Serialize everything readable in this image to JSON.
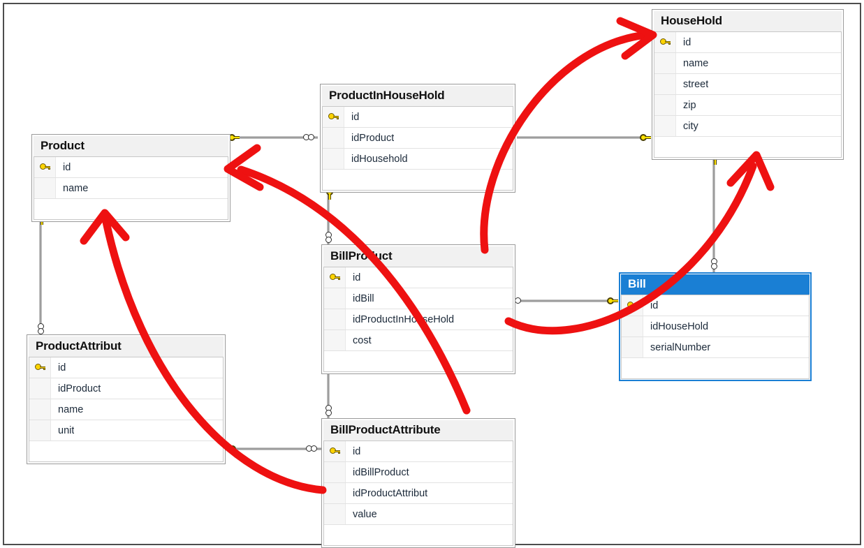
{
  "diagram": {
    "kind": "database-er-diagram",
    "border_color": "#4d4d4d",
    "background": "#ffffff",
    "selected_table": "Bill",
    "selection_color": "#1a7fd4",
    "annotation_color": "#ee1111"
  },
  "tables": [
    {
      "id": "product",
      "name": "Product",
      "selected": false,
      "fields": [
        {
          "name": "id",
          "primary_key": true
        },
        {
          "name": "name",
          "primary_key": false
        }
      ]
    },
    {
      "id": "productinhousehold",
      "name": "ProductInHouseHold",
      "selected": false,
      "fields": [
        {
          "name": "id",
          "primary_key": true
        },
        {
          "name": "idProduct",
          "primary_key": false
        },
        {
          "name": "idHousehold",
          "primary_key": false
        }
      ]
    },
    {
      "id": "household",
      "name": "HouseHold",
      "selected": false,
      "fields": [
        {
          "name": "id",
          "primary_key": true
        },
        {
          "name": "name",
          "primary_key": false
        },
        {
          "name": "street",
          "primary_key": false
        },
        {
          "name": "zip",
          "primary_key": false
        },
        {
          "name": "city",
          "primary_key": false
        }
      ]
    },
    {
      "id": "billproduct",
      "name": "BillProduct",
      "selected": false,
      "fields": [
        {
          "name": "id",
          "primary_key": true
        },
        {
          "name": "idBill",
          "primary_key": false
        },
        {
          "name": "idProductInHouseHold",
          "primary_key": false
        },
        {
          "name": "cost",
          "primary_key": false
        }
      ]
    },
    {
      "id": "bill",
      "name": "Bill",
      "selected": true,
      "fields": [
        {
          "name": "id",
          "primary_key": true
        },
        {
          "name": "idHouseHold",
          "primary_key": false
        },
        {
          "name": "serialNumber",
          "primary_key": false
        }
      ]
    },
    {
      "id": "productattribut",
      "name": "ProductAttribut",
      "selected": false,
      "fields": [
        {
          "name": "id",
          "primary_key": true
        },
        {
          "name": "idProduct",
          "primary_key": false
        },
        {
          "name": "name",
          "primary_key": false
        },
        {
          "name": "unit",
          "primary_key": false
        }
      ]
    },
    {
      "id": "billproductattribute",
      "name": "BillProductAttribute",
      "selected": false,
      "fields": [
        {
          "name": "id",
          "primary_key": true
        },
        {
          "name": "idBillProduct",
          "primary_key": false
        },
        {
          "name": "idProductAttribut",
          "primary_key": false
        },
        {
          "name": "value",
          "primary_key": false
        }
      ]
    }
  ],
  "relationships": [
    {
      "id": "rel-product-pihh",
      "one_table": "Product",
      "many_table": "ProductInHouseHold",
      "one_marker": "key-icon",
      "many_marker": "infinity-icon"
    },
    {
      "id": "rel-pihh-household",
      "one_table": "HouseHold",
      "many_table": "ProductInHouseHold",
      "one_marker": "key-icon",
      "many_marker": "infinity-icon"
    },
    {
      "id": "rel-pihh-billprod",
      "one_table": "ProductInHouseHold",
      "many_table": "BillProduct",
      "one_marker": "key-icon",
      "many_marker": "infinity-icon"
    },
    {
      "id": "rel-bill-billprod",
      "one_table": "Bill",
      "many_table": "BillProduct",
      "one_marker": "key-icon",
      "many_marker": "infinity-icon"
    },
    {
      "id": "rel-household-bill",
      "one_table": "HouseHold",
      "many_table": "Bill",
      "one_marker": "key-icon",
      "many_marker": "infinity-icon"
    },
    {
      "id": "rel-product-pattr",
      "one_table": "Product",
      "many_table": "ProductAttribut",
      "one_marker": "key-icon",
      "many_marker": "infinity-icon"
    },
    {
      "id": "rel-pattr-bpattr",
      "one_table": "ProductAttribut",
      "many_table": "BillProductAttribute",
      "one_marker": "key-icon",
      "many_marker": "infinity-icon"
    },
    {
      "id": "rel-billprod-bpattr",
      "one_table": "BillProduct",
      "many_table": "BillProductAttribute",
      "one_marker": "key-icon",
      "many_marker": "infinity-icon"
    }
  ],
  "annotations": [
    {
      "id": "arrow-to-household",
      "shape": "red-curved-arrow",
      "from": "BillProduct",
      "to": "HouseHold"
    },
    {
      "id": "arrow-to-product",
      "shape": "red-curved-arrow",
      "from": "BillProductAttribute",
      "to": "Product"
    },
    {
      "id": "arrow-to-product-lower",
      "shape": "red-curved-arrow",
      "from": "BillProductAttribute",
      "to": "Product"
    },
    {
      "id": "arrow-to-household-lower",
      "shape": "red-curved-arrow",
      "from": "BillProduct",
      "to": "HouseHold"
    }
  ]
}
